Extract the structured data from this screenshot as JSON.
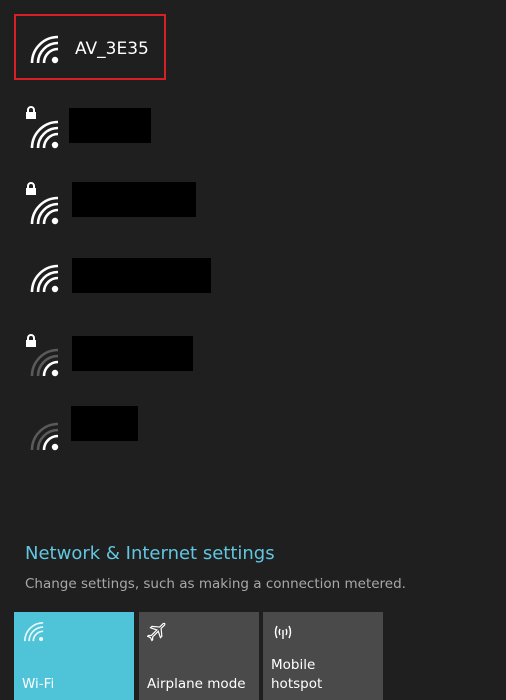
{
  "networks": [
    {
      "name": "AV_3E35",
      "secured": false,
      "signal": "full",
      "highlighted": true
    },
    {
      "name": "",
      "secured": true,
      "signal": "full",
      "redacted": true
    },
    {
      "name": "",
      "secured": true,
      "signal": "full",
      "redacted": true
    },
    {
      "name": "",
      "secured": false,
      "signal": "full",
      "redacted": true
    },
    {
      "name": "",
      "secured": true,
      "signal": "weak",
      "redacted": true
    },
    {
      "name": "",
      "secured": false,
      "signal": "weak",
      "redacted": true
    }
  ],
  "settings": {
    "link": "Network & Internet settings",
    "description": "Change settings, such as making a connection metered."
  },
  "quick_actions": {
    "wifi": {
      "label": "Wi-Fi",
      "icon": "wifi-icon",
      "active": true
    },
    "airplane": {
      "label": "Airplane mode",
      "icon": "airplane-icon",
      "active": false
    },
    "hotspot": {
      "label_line1": "Mobile",
      "label_line2": "hotspot",
      "icon": "hotspot-icon",
      "active": false
    }
  },
  "colors": {
    "background": "#1f1f1f",
    "accent": "#4fc3d8",
    "link": "#62c6e0",
    "highlight": "#d91f26",
    "tile_inactive": "#4a4a4a"
  }
}
